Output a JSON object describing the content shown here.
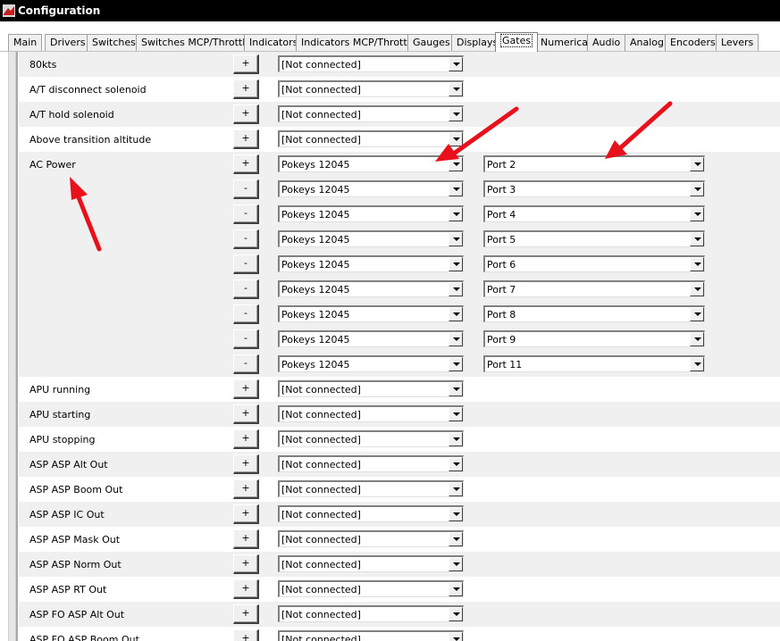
{
  "window": {
    "title": "Configuration"
  },
  "tabs": [
    {
      "label": "Main",
      "active": false
    },
    {
      "label": "Drivers",
      "active": false
    },
    {
      "label": "Switches",
      "active": false
    },
    {
      "label": "Switches MCP/Throttle",
      "active": false
    },
    {
      "label": "Indicators",
      "active": false
    },
    {
      "label": "Indicators MCP/Throttle",
      "active": false
    },
    {
      "label": "Gauges",
      "active": false
    },
    {
      "label": "Displays",
      "active": false
    },
    {
      "label": "Gates",
      "active": true
    },
    {
      "label": "Numerical",
      "active": false
    },
    {
      "label": "Audio",
      "active": false
    },
    {
      "label": "Analog",
      "active": false
    },
    {
      "label": "Encoders",
      "active": false
    },
    {
      "label": "Levers",
      "active": false
    }
  ],
  "gates": [
    {
      "label": "80kts",
      "button": "+",
      "device": "[Not connected]",
      "port": ""
    },
    {
      "label": "A/T disconnect solenoid",
      "button": "+",
      "device": "[Not connected]",
      "port": ""
    },
    {
      "label": "A/T hold solenoid",
      "button": "+",
      "device": "[Not connected]",
      "port": ""
    },
    {
      "label": "Above transition altitude",
      "button": "+",
      "device": "[Not connected]",
      "port": ""
    },
    {
      "label": "AC Power",
      "button": "+",
      "device": "Pokeys 12045",
      "port": "Port 2"
    },
    {
      "label": "",
      "button": "-",
      "device": "Pokeys 12045",
      "port": "Port 3"
    },
    {
      "label": "",
      "button": "-",
      "device": "Pokeys 12045",
      "port": "Port 4"
    },
    {
      "label": "",
      "button": "-",
      "device": "Pokeys 12045",
      "port": "Port 5"
    },
    {
      "label": "",
      "button": "-",
      "device": "Pokeys 12045",
      "port": "Port 6"
    },
    {
      "label": "",
      "button": "-",
      "device": "Pokeys 12045",
      "port": "Port 7"
    },
    {
      "label": "",
      "button": "-",
      "device": "Pokeys 12045",
      "port": "Port 8"
    },
    {
      "label": "",
      "button": "-",
      "device": "Pokeys 12045",
      "port": "Port 9"
    },
    {
      "label": "",
      "button": "-",
      "device": "Pokeys 12045",
      "port": "Port 11"
    },
    {
      "label": "APU running",
      "button": "+",
      "device": "[Not connected]",
      "port": ""
    },
    {
      "label": "APU starting",
      "button": "+",
      "device": "[Not connected]",
      "port": ""
    },
    {
      "label": "APU stopping",
      "button": "+",
      "device": "[Not connected]",
      "port": ""
    },
    {
      "label": "ASP ASP Alt Out",
      "button": "+",
      "device": "[Not connected]",
      "port": ""
    },
    {
      "label": "ASP ASP Boom Out",
      "button": "+",
      "device": "[Not connected]",
      "port": ""
    },
    {
      "label": "ASP ASP IC Out",
      "button": "+",
      "device": "[Not connected]",
      "port": ""
    },
    {
      "label": "ASP ASP Mask Out",
      "button": "+",
      "device": "[Not connected]",
      "port": ""
    },
    {
      "label": "ASP ASP Norm Out",
      "button": "+",
      "device": "[Not connected]",
      "port": ""
    },
    {
      "label": "ASP ASP RT Out",
      "button": "+",
      "device": "[Not connected]",
      "port": ""
    },
    {
      "label": "ASP FO ASP Alt Out",
      "button": "+",
      "device": "[Not connected]",
      "port": ""
    },
    {
      "label": "ASP FO ASP Boom Out",
      "button": "+",
      "device": "[Not connected]",
      "port": ""
    }
  ],
  "colors": {
    "annotation_arrow": "#e8101a",
    "row_shaded": "#f0f0f0"
  }
}
